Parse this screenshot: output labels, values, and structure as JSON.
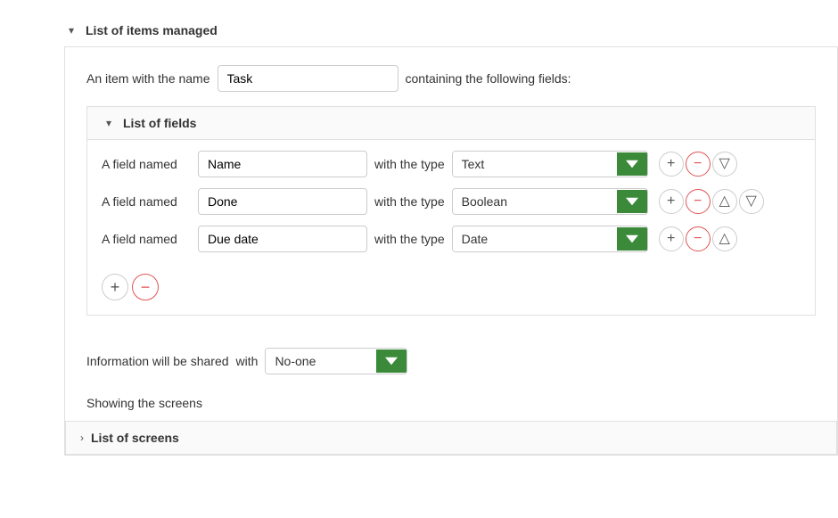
{
  "top_section": {
    "chevron": "▾",
    "title": "List of items managed"
  },
  "item_name_row": {
    "prefix": "An item with the name",
    "name_value": "Task",
    "suffix": "containing the following fields:"
  },
  "fields_section": {
    "chevron": "▾",
    "title": "List of fields",
    "fields": [
      {
        "label": "A field named",
        "name": "Name",
        "type_label": "with the type",
        "type_value": "Text"
      },
      {
        "label": "A field named",
        "name": "Done",
        "type_label": "with the type",
        "type_value": "Boolean"
      },
      {
        "label": "A field named",
        "name": "Due date",
        "type_label": "with the type",
        "type_value": "Date"
      }
    ],
    "add_btn": "+",
    "remove_btn": "−"
  },
  "share_row": {
    "label": "Information will be shared",
    "with_label": "with",
    "value": "No-one"
  },
  "showing_label": "Showing the screens",
  "screens_section": {
    "chevron": "›",
    "title": "List of screens"
  }
}
